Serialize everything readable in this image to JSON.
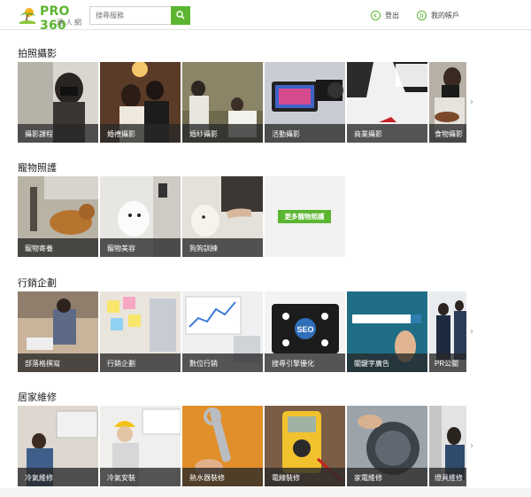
{
  "header": {
    "brand": "PRO 360",
    "brand_sub": "達人網",
    "search_placeholder": "搜尋服務",
    "login_label": "登出",
    "account_label": "我的帳戶"
  },
  "sections": [
    {
      "title": "拍照攝影",
      "tiles": [
        "攝影課程",
        "婚禮攝影",
        "婚紗攝影",
        "活動攝影",
        "商業攝影",
        "食物攝影"
      ]
    },
    {
      "title": "寵物照護",
      "tiles": [
        "寵物寄養",
        "寵物美容",
        "狗狗訓練"
      ],
      "more_label": "更多寵物照護"
    },
    {
      "title": "行銷企劃",
      "tiles": [
        "部落格撰寫",
        "行銷企劃",
        "數位行銷",
        "搜尋引擎優化",
        "關鍵字廣告",
        "PR公關"
      ]
    },
    {
      "title": "居家維修",
      "tiles": [
        "冷氣維修",
        "冷氣安裝",
        "熱水器裝修",
        "電線裝修",
        "家電維修",
        "燈具維修"
      ]
    }
  ],
  "colors": {
    "accent": "#5cb531",
    "caption_bg": "#282828"
  }
}
